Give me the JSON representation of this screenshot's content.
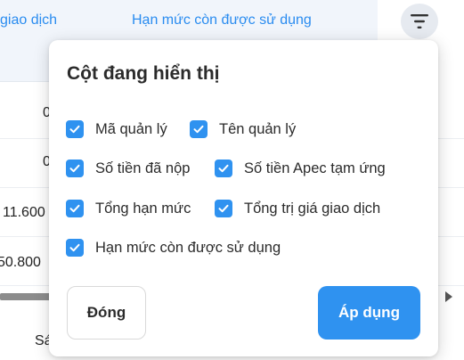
{
  "table": {
    "headers": [
      "giao dịch",
      "Hạn mức còn được sử dụng"
    ],
    "cells": [
      "0",
      "0",
      "11.600",
      "50.800",
      "Sá"
    ]
  },
  "popup": {
    "title": "Cột đang hiển thị",
    "options": [
      {
        "label": "Mã quản lý",
        "checked": true
      },
      {
        "label": "Tên quản lý",
        "checked": true
      },
      {
        "label": "Số tiền đã nộp",
        "checked": true
      },
      {
        "label": "Số tiền Apec tạm ứng",
        "checked": true
      },
      {
        "label": "Tổng hạn mức",
        "checked": true
      },
      {
        "label": "Tổng trị giá giao dịch",
        "checked": true
      },
      {
        "label": "Hạn mức còn được sử dụng",
        "checked": true
      }
    ],
    "close_label": "Đóng",
    "apply_label": "Áp dụng"
  },
  "icons": {
    "filter": "filter-icon",
    "checkbox": "check-icon",
    "scroll_arrow": "arrow-right-icon"
  },
  "colors": {
    "accent": "#2f92f0",
    "header_link": "#2a8cf0",
    "header_bg": "#f1f5fb"
  }
}
